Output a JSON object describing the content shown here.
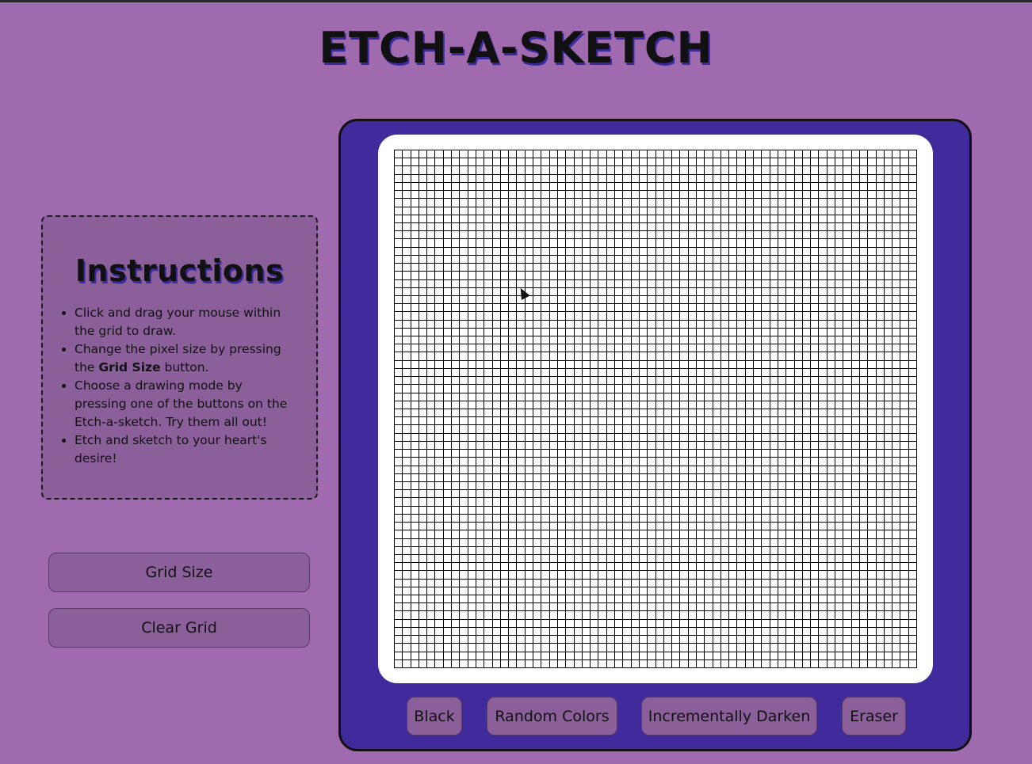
{
  "page": {
    "title": "ETCH-A-SKETCH"
  },
  "instructions": {
    "heading": "Instructions",
    "items": [
      {
        "text": "Click and drag your mouse within the grid to draw."
      },
      {
        "before": "Change the pixel size by pressing the ",
        "bold": "Grid Size",
        "after": " button."
      },
      {
        "text": "Choose a drawing mode by pressing one of the buttons on the Etch-a-sketch. Try them all out!"
      },
      {
        "text": "Etch and sketch to your heart's desire!"
      }
    ]
  },
  "controls": {
    "grid_size_label": "Grid Size",
    "clear_grid_label": "Clear Grid"
  },
  "modes": {
    "black_label": "Black",
    "random_label": "Random Colors",
    "darken_label": "Incrementally Darken",
    "eraser_label": "Eraser"
  },
  "grid": {
    "columns": 64,
    "rows": 64
  },
  "colors": {
    "background": "#a06aae",
    "panel": "#8b5f9a",
    "frame": "#402a9c",
    "screen": "#ffffff",
    "title_shadow": "#3a2aa0"
  }
}
